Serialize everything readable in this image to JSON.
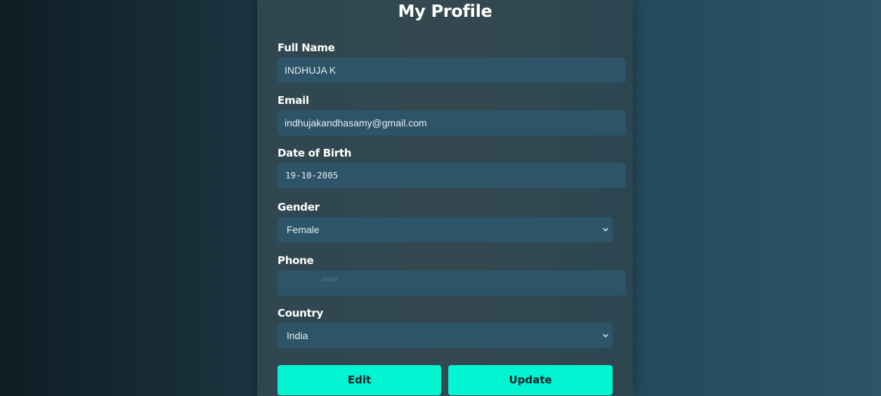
{
  "profile": {
    "title": "My Profile",
    "full_name": {
      "label": "Full Name",
      "value": "INDHUJA K"
    },
    "email": {
      "label": "Email",
      "value": "indhujakandhasamy@gmail.com"
    },
    "dob": {
      "label": "Date of Birth",
      "value": "19-10-2005"
    },
    "gender": {
      "label": "Gender",
      "value": "Female"
    },
    "phone": {
      "label": "Phone",
      "value": ""
    },
    "country": {
      "label": "Country",
      "value": "India"
    }
  },
  "buttons": {
    "edit": "Edit",
    "update": "Update"
  },
  "colors": {
    "accent": "#00f5d0",
    "field_bg": "#2e5467"
  },
  "icons": {
    "select_arrow": "chevron-down-icon"
  }
}
